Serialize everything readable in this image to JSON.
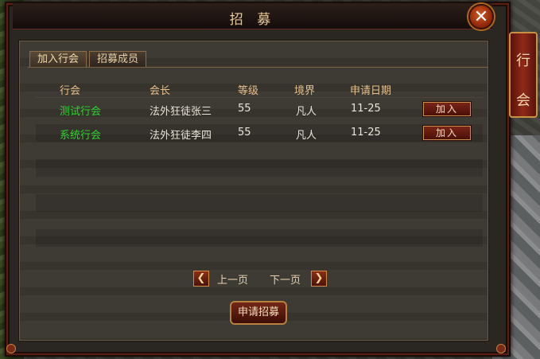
{
  "window": {
    "title": "招 募",
    "close_label": "✕"
  },
  "tabs": [
    {
      "label": "加入行会",
      "active": true
    },
    {
      "label": "招募成员",
      "active": false
    }
  ],
  "table": {
    "headers": {
      "guild": "行会",
      "leader": "会长",
      "level": "等级",
      "realm": "境界",
      "date": "申请日期"
    },
    "rows": [
      {
        "guild": "测试行会",
        "leader": "法外狂徒张三",
        "level": "55",
        "realm": "凡人",
        "date": "11-25",
        "action": "加入"
      },
      {
        "guild": "系统行会",
        "leader": "法外狂徒李四",
        "level": "55",
        "realm": "凡人",
        "date": "11-25",
        "action": "加入"
      }
    ]
  },
  "pagination": {
    "prev_label": "上一页",
    "next_label": "下一页"
  },
  "apply_button": "申请招募",
  "side_tab": {
    "line1": "行",
    "line2": "会"
  },
  "colors": {
    "guild_name": "#2bd62e",
    "header": "#e6c18c",
    "accent": "#c89244"
  }
}
